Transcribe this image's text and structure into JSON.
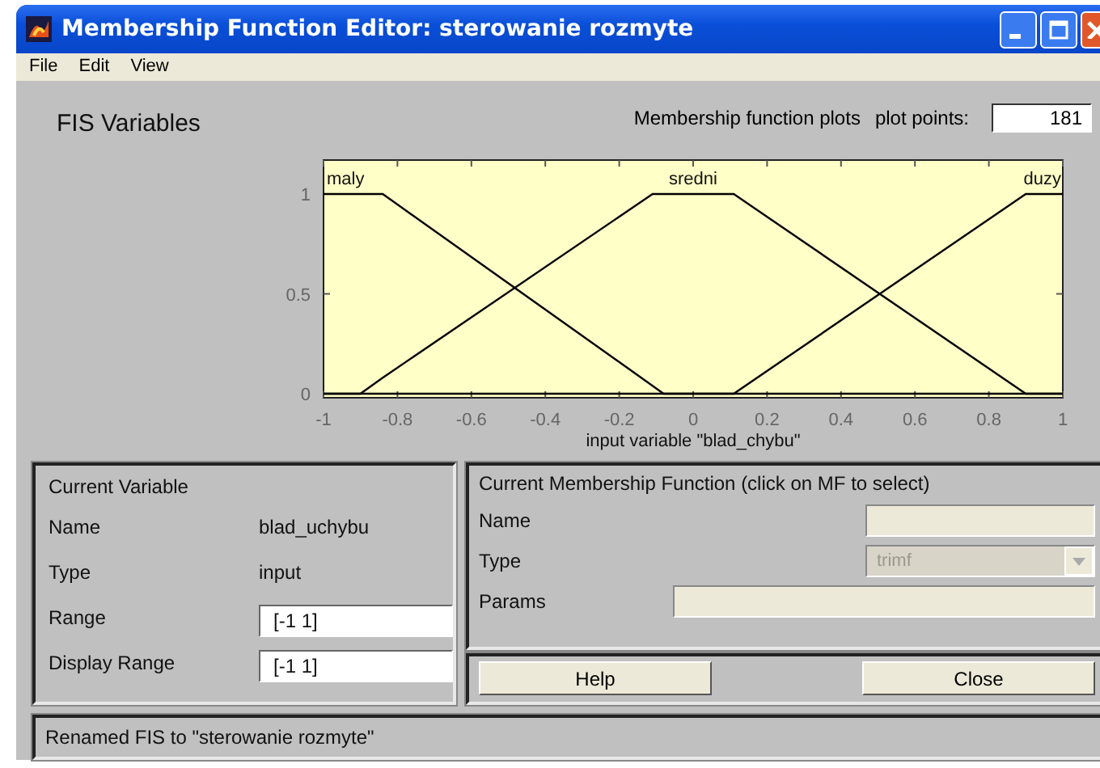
{
  "window": {
    "title": "Membership Function Editor: sterowanie rozmyte"
  },
  "menu": [
    "File",
    "Edit",
    "View"
  ],
  "fis_variables": {
    "label": "FIS Variables"
  },
  "plot_header": {
    "label": "Membership function plots",
    "points_label": "plot points:",
    "points_value": "181"
  },
  "plot": {
    "chart_data": {
      "type": "line",
      "xlabel": "input variable \"blad_chybu\"",
      "x": [
        -1,
        -0.9,
        -0.84,
        -0.11,
        -0.08,
        0.11,
        0.9,
        1
      ],
      "series": [
        {
          "name": "maly",
          "color": "#000000",
          "values": [
            1,
            1,
            1,
            0.04,
            0,
            0,
            0,
            0
          ]
        },
        {
          "name": "sredni",
          "color": "#000000",
          "values": [
            0,
            0,
            0.08,
            1,
            1,
            1,
            0,
            0
          ]
        },
        {
          "name": "duzy",
          "color": "#000000",
          "values": [
            0,
            0,
            0,
            0,
            0,
            0,
            1,
            1
          ]
        }
      ],
      "xlim": [
        -1,
        1
      ],
      "ylim": [
        -0.02,
        1.17
      ],
      "xticks": [
        -1,
        -0.8,
        -0.6,
        -0.4,
        -0.2,
        0,
        0.2,
        0.4,
        0.6,
        0.8,
        1
      ],
      "yticks": [
        0,
        0.5,
        1
      ]
    }
  },
  "current_variable": {
    "title": "Current Variable",
    "name_label": "Name",
    "name": "blad_uchybu",
    "type_label": "Type",
    "type": "input",
    "range_label": "Range",
    "range": "[-1 1]",
    "display_range_label": "Display Range",
    "display_range": "[-1 1]"
  },
  "current_mf": {
    "title": "Current Membership Function (click on MF to select)",
    "name_label": "Name",
    "type_label": "Type",
    "type_value": "trimf",
    "type_disabled": true,
    "params_label": "Params"
  },
  "buttons": [
    "Help",
    "Close"
  ],
  "status_bar": "Renamed FIS to \"sterowanie rozmyte\""
}
